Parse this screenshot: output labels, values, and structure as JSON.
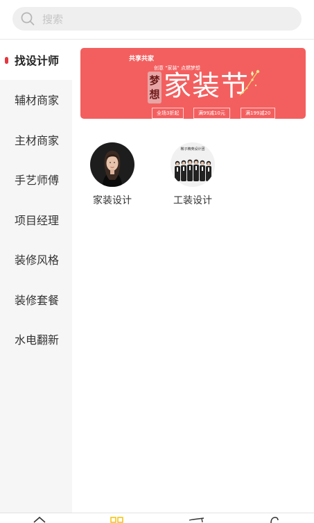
{
  "search": {
    "placeholder": "搜索"
  },
  "sidebar": {
    "items": [
      {
        "label": "找设计师",
        "active": true
      },
      {
        "label": "辅材商家"
      },
      {
        "label": "主材商家"
      },
      {
        "label": "手艺师傅"
      },
      {
        "label": "项目经理"
      },
      {
        "label": "装修风格"
      },
      {
        "label": "装修套餐"
      },
      {
        "label": "水电翻新"
      }
    ]
  },
  "banner": {
    "brand": "共享共家",
    "subtitle": "创意 \"家装\" 点燃梦想",
    "dream": [
      "梦",
      "想"
    ],
    "title": "家装节",
    "promos": [
      "全场3折起",
      "满99减10元",
      "满199减20"
    ],
    "color": "#f35f5f"
  },
  "categories": [
    {
      "label": "家装设计",
      "icon": "female-designer-avatar"
    },
    {
      "label": "工装设计",
      "icon": "team-photo-avatar",
      "photo_caption": "椭子精英设计团"
    }
  ],
  "tabbar": {
    "icons": [
      "home-icon",
      "category-icon",
      "cart-icon",
      "user-icon"
    ],
    "accent": "#f5c518"
  },
  "colors": {
    "active_marker": "#e6363f",
    "sidebar_bg": "#f6f6f6"
  }
}
